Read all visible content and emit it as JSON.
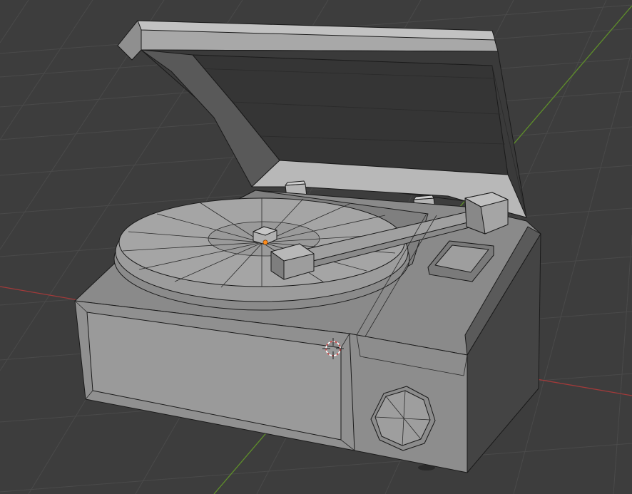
{
  "viewport": {
    "background_color": "#3d3d3d",
    "grid_color": "#4a4a4a",
    "x_axis_color": "#a23a3a",
    "y_axis_color": "#5f8f2a",
    "origin_marker_color": "#e07a3a",
    "selected_origin_color": "#ff8c1a"
  },
  "scene": {
    "object": "record-player",
    "shading": "solid-gray",
    "icons": [
      "3d-cursor-icon",
      "object-origin-icon"
    ]
  }
}
